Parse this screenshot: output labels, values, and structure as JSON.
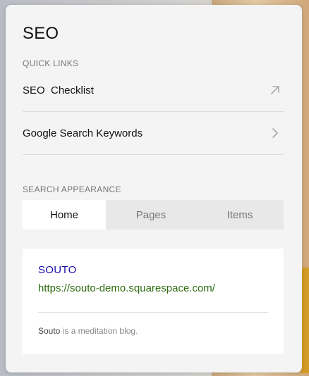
{
  "panel": {
    "title": "SEO"
  },
  "quick_links": {
    "label": "QUICK LINKS",
    "items": [
      {
        "label": "SEO  Checklist",
        "icon": "external-arrow-icon"
      },
      {
        "label": "Google Search Keywords",
        "icon": "chevron-right-icon"
      }
    ]
  },
  "search_appearance": {
    "label": "SEARCH APPEARANCE",
    "tabs": [
      {
        "label": "Home",
        "active": true
      },
      {
        "label": "Pages",
        "active": false
      },
      {
        "label": "Items",
        "active": false
      }
    ],
    "preview": {
      "site_title": "SOUTO",
      "url": "https://souto-demo.squarespace.com/",
      "description_site": "Souto",
      "description_text": " is a meditation blog."
    }
  },
  "colors": {
    "link_title": "#1a0dab",
    "link_url": "#2d6a0d",
    "panel_bg": "#f4f4f4"
  }
}
